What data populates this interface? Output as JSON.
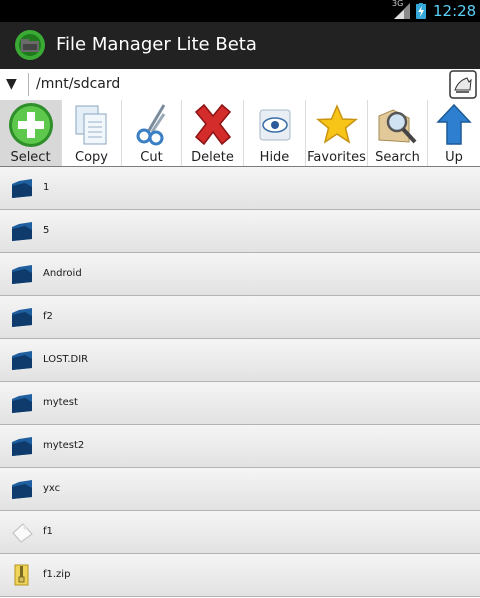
{
  "status_bar": {
    "time": "12:28",
    "network": "3G"
  },
  "app": {
    "title": "File Manager Lite Beta"
  },
  "path_bar": {
    "path": "/mnt/sdcard"
  },
  "toolbar": {
    "items": [
      {
        "label": "Select",
        "icon": "plus-circle-icon"
      },
      {
        "label": "Copy",
        "icon": "copy-documents-icon"
      },
      {
        "label": "Cut",
        "icon": "scissors-icon"
      },
      {
        "label": "Delete",
        "icon": "red-x-icon"
      },
      {
        "label": "Hide",
        "icon": "eye-icon"
      },
      {
        "label": "Favorites",
        "icon": "star-icon"
      },
      {
        "label": "Search",
        "icon": "magnifier-folder-icon"
      },
      {
        "label": "Up",
        "icon": "up-arrow-icon"
      }
    ]
  },
  "files": [
    {
      "name": "1",
      "type": "folder"
    },
    {
      "name": "5",
      "type": "folder"
    },
    {
      "name": "Android",
      "type": "folder"
    },
    {
      "name": "f2",
      "type": "folder"
    },
    {
      "name": "LOST.DIR",
      "type": "folder"
    },
    {
      "name": "mytest",
      "type": "folder"
    },
    {
      "name": "mytest2",
      "type": "folder"
    },
    {
      "name": "yxc",
      "type": "folder"
    },
    {
      "name": "f1",
      "type": "file"
    },
    {
      "name": "f1.zip",
      "type": "zip"
    }
  ],
  "colors": {
    "action_bar": "#222222",
    "status_time": "#5ad0f8",
    "folder": "#1f5f9f"
  }
}
